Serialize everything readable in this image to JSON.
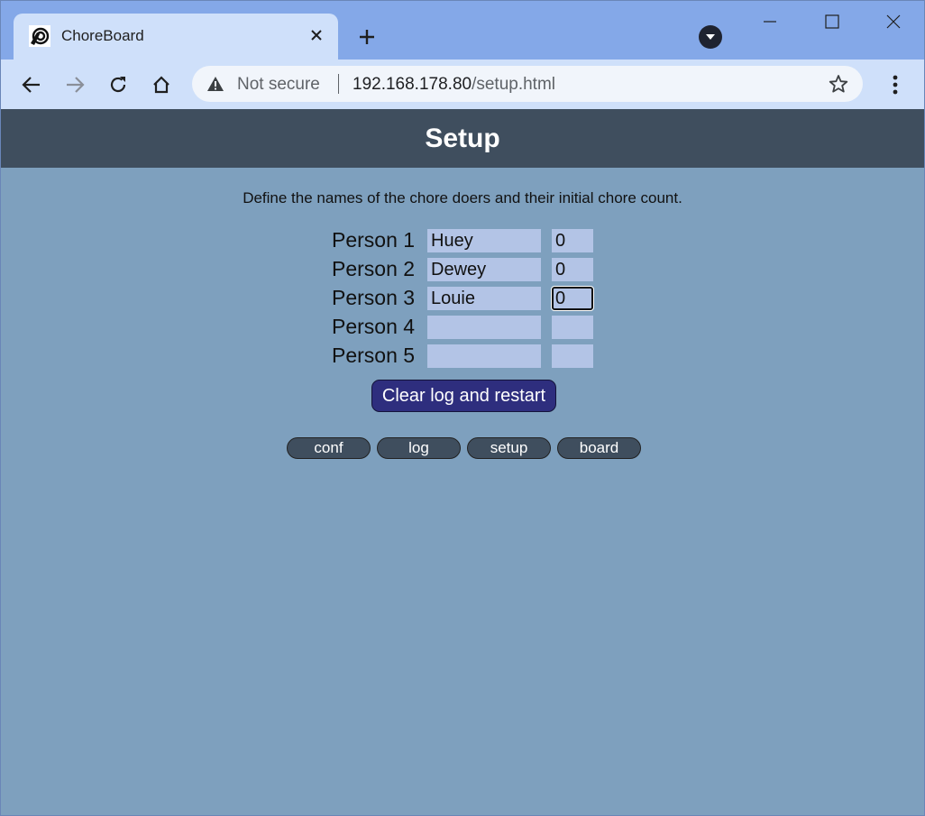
{
  "browser": {
    "tab_title": "ChoreBoard",
    "security_label": "Not secure",
    "url_host": "192.168.178.80",
    "url_path": "/setup.html"
  },
  "page": {
    "title": "Setup",
    "intro": "Define the names of the chore doers and their initial chore count.",
    "people": [
      {
        "label": "Person 1",
        "name": "Huey",
        "count": "0"
      },
      {
        "label": "Person 2",
        "name": "Dewey",
        "count": "0"
      },
      {
        "label": "Person 3",
        "name": "Louie",
        "count": "0"
      },
      {
        "label": "Person 4",
        "name": "",
        "count": ""
      },
      {
        "label": "Person 5",
        "name": "",
        "count": ""
      }
    ],
    "clear_button": "Clear log and restart",
    "nav": [
      "conf",
      "log",
      "setup",
      "board"
    ]
  },
  "colors": {
    "page_background": "#7ea0be",
    "header_background": "#3f4e5e",
    "field_background": "#b3c4e6",
    "primary_button": "#2e2e7e"
  }
}
